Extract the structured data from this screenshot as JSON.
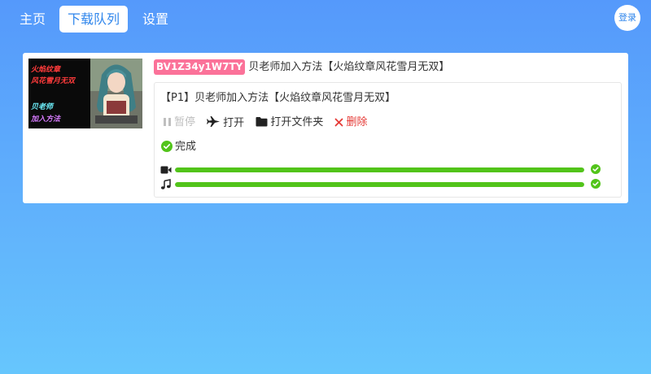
{
  "nav": {
    "tabs": [
      {
        "label": "主页",
        "active": false
      },
      {
        "label": "下载队列",
        "active": true
      },
      {
        "label": "设置",
        "active": false
      }
    ],
    "login_label": "登录"
  },
  "item": {
    "bvid": "BV1Z34y1W7TY",
    "title": "贝老师加入方法【火焰纹章风花雪月无双】",
    "thumbnail_text": [
      "火焰纹章",
      "风花雪月无双",
      "贝老师",
      "加入方法"
    ],
    "part_title": "【P1】贝老师加入方法【火焰纹章风花雪月无双】",
    "actions": {
      "pause": "暂停",
      "open": "打开",
      "open_folder": "打开文件夹",
      "delete": "删除"
    },
    "status": "完成",
    "progress": {
      "video": 1.0,
      "audio": 1.0
    }
  },
  "colors": {
    "accent": "#2f86ec",
    "bv_badge": "#fb7299",
    "success": "#52c41a",
    "danger": "#e53935"
  },
  "icons": [
    "pause-icon",
    "plane-icon",
    "folder-icon",
    "close-icon",
    "check-circle-icon",
    "video-icon",
    "music-icon"
  ]
}
